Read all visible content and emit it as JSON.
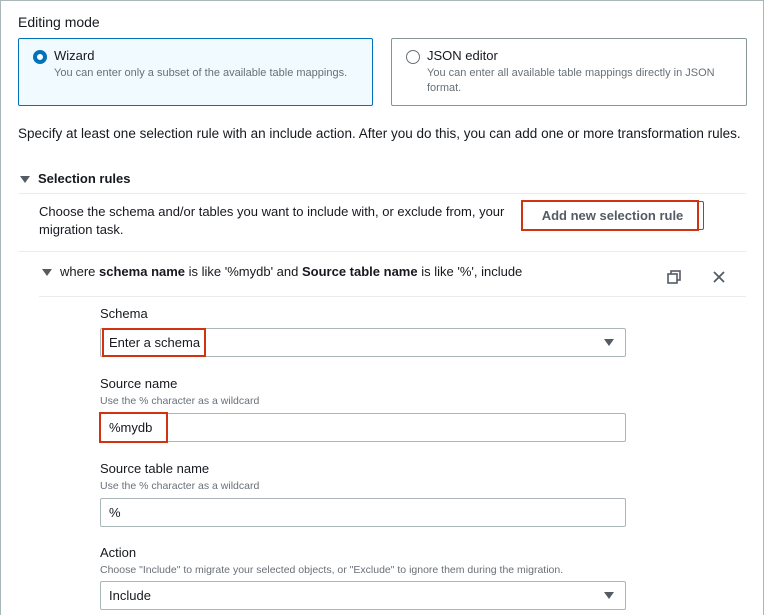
{
  "editing_mode": {
    "label": "Editing mode",
    "options": [
      {
        "title": "Wizard",
        "description": "You can enter only a subset of the available table mappings.",
        "selected": true
      },
      {
        "title": "JSON editor",
        "description": "You can enter all available table mappings directly in JSON format.",
        "selected": false
      }
    ]
  },
  "instruction": "Specify at least one selection rule with an include action. After you do this, you can add one or more transformation rules.",
  "selection_rules": {
    "title": "Selection rules",
    "description": "Choose the schema and/or tables you want to include with, or exclude from, your migration task.",
    "add_button_label": "Add new selection rule",
    "rule": {
      "summary_prefix": "where ",
      "summary_schema_bold": "schema name",
      "summary_mid1": " is like '%mydb' and ",
      "summary_table_bold": "Source table name",
      "summary_mid2": " is like '%', include",
      "schema": {
        "label": "Schema",
        "value": "Enter a schema"
      },
      "source_name": {
        "label": "Source name",
        "hint": "Use the % character as a wildcard",
        "value": "%mydb"
      },
      "source_table_name": {
        "label": "Source table name",
        "hint": "Use the % character as a wildcard",
        "value": "%"
      },
      "action": {
        "label": "Action",
        "hint": "Choose \"Include\" to migrate your selected objects, or \"Exclude\" to ignore them during the migration.",
        "value": "Include"
      }
    }
  },
  "icons": {
    "copy": "copy-icon",
    "close": "close-icon",
    "expand": "caret-down-icon",
    "dropdown": "chevron-down-icon"
  },
  "colors": {
    "accent": "#0073bb",
    "highlight": "#d13212",
    "border": "#aab7b8",
    "muted_text": "#687078"
  }
}
